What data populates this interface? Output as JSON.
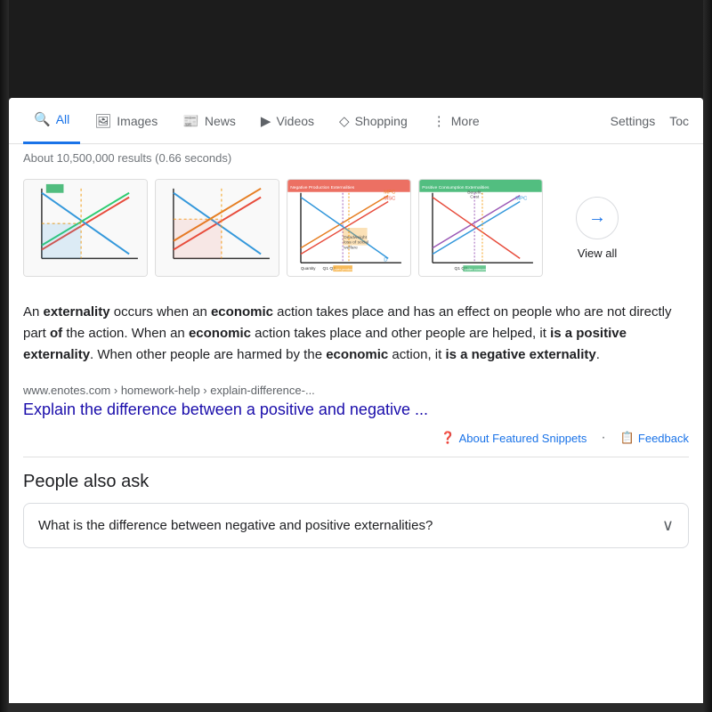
{
  "topbar": {
    "visible": true
  },
  "tabs": {
    "items": [
      {
        "label": "All",
        "icon": "🔍",
        "active": true,
        "name": "all"
      },
      {
        "label": "Images",
        "icon": "🖼",
        "active": false,
        "name": "images"
      },
      {
        "label": "News",
        "icon": "📰",
        "active": false,
        "name": "news"
      },
      {
        "label": "Videos",
        "icon": "▶",
        "active": false,
        "name": "videos"
      },
      {
        "label": "Shopping",
        "icon": "◇",
        "active": false,
        "name": "shopping"
      },
      {
        "label": "More",
        "icon": "⋮",
        "active": false,
        "name": "more"
      }
    ],
    "settings_label": "Settings",
    "tools_label": "Toc"
  },
  "results_count": "About 10,500,000 results (0.66 seconds)",
  "view_all": {
    "label": "View all",
    "arrow": "→"
  },
  "snippet": {
    "text_parts": [
      {
        "text": "An ",
        "bold": false
      },
      {
        "text": "externality",
        "bold": true
      },
      {
        "text": " occurs when an ",
        "bold": false
      },
      {
        "text": "economic",
        "bold": true
      },
      {
        "text": " action takes place and has an effect on people who are not directly part ",
        "bold": false
      },
      {
        "text": "of",
        "bold": true
      },
      {
        "text": " the action. When an ",
        "bold": false
      },
      {
        "text": "economic",
        "bold": true
      },
      {
        "text": " action takes place and other people are helped, it ",
        "bold": false
      },
      {
        "text": "is a ",
        "bold": false
      },
      {
        "text": "positive externality",
        "bold": true
      },
      {
        "text": ". When other people are harmed by the ",
        "bold": false
      },
      {
        "text": "economic",
        "bold": true
      },
      {
        "text": " action, it ",
        "bold": false
      },
      {
        "text": "is a ",
        "bold": false
      },
      {
        "text": "negative externality",
        "bold": true
      },
      {
        "text": ".",
        "bold": false
      }
    ],
    "full_text": "An externality occurs when an economic action takes place and has an effect on people who are not directly part of the action. When an economic action takes place and other people are helped, it is a positive externality. When other people are harmed by the economic action, it is a negative externality."
  },
  "source": {
    "url": "www.enotes.com › homework-help › explain-difference-...",
    "title": "Explain the difference between a positive and negative ..."
  },
  "snippet_footer": {
    "about_label": "About Featured Snippets",
    "feedback_label": "Feedback"
  },
  "paa": {
    "title": "People also ask",
    "questions": [
      {
        "text": "What is the difference between negative and positive externalities?"
      }
    ]
  }
}
